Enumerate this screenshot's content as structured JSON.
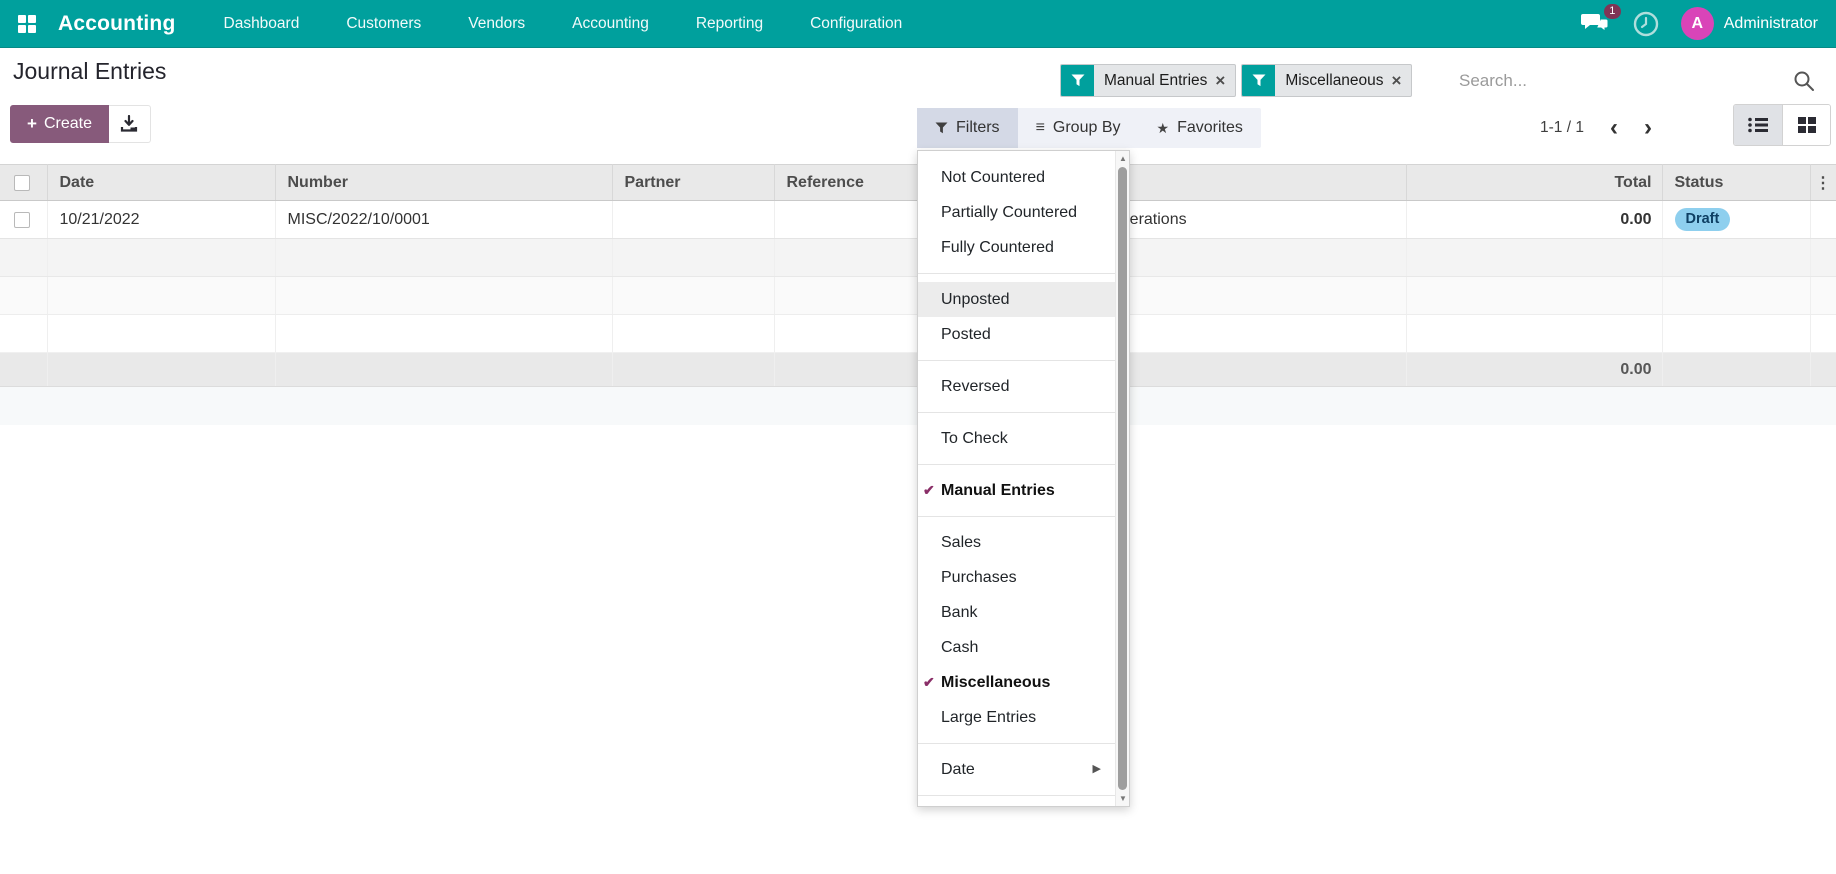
{
  "app": {
    "name": "Accounting",
    "menu_items": [
      "Dashboard",
      "Customers",
      "Vendors",
      "Accounting",
      "Reporting",
      "Configuration"
    ],
    "message_count": "1",
    "user_name": "Administrator",
    "user_initial": "A"
  },
  "page": {
    "title": "Journal Entries"
  },
  "toolbar": {
    "create_label": "Create"
  },
  "search": {
    "placeholder": "Search...",
    "facets": [
      {
        "label": "Manual Entries"
      },
      {
        "label": "Miscellaneous"
      }
    ]
  },
  "control_buttons": {
    "filters": "Filters",
    "group_by": "Group By",
    "favorites": "Favorites"
  },
  "pager": {
    "range": "1-1 / 1"
  },
  "table": {
    "headers": {
      "date": "Date",
      "number": "Number",
      "partner": "Partner",
      "reference": "Reference",
      "total": "Total",
      "status": "Status"
    },
    "rows": [
      {
        "date": "10/21/2022",
        "number": "MISC/2022/10/0001",
        "partner": "",
        "reference": "",
        "journal": "Miscellaneous Operations",
        "total": "0.00",
        "status": "Draft"
      }
    ],
    "aggregate_total": "0.00"
  },
  "filters_menu": {
    "items": [
      {
        "label": "Not Countered"
      },
      {
        "label": "Partially Countered"
      },
      {
        "label": "Fully Countered"
      },
      {
        "label": "Unposted",
        "highlighted": true
      },
      {
        "label": "Posted"
      },
      {
        "label": "Reversed"
      },
      {
        "label": "To Check"
      },
      {
        "label": "Manual Entries",
        "checked": true
      },
      {
        "label": "Sales"
      },
      {
        "label": "Purchases"
      },
      {
        "label": "Bank"
      },
      {
        "label": "Cash"
      },
      {
        "label": "Miscellaneous",
        "checked": true
      },
      {
        "label": "Large Entries"
      },
      {
        "label": "Date",
        "has_submenu": true
      }
    ]
  },
  "icons": {
    "plus": "+",
    "close": "×",
    "star": "★",
    "group_by": "≡",
    "chevron_left": "‹",
    "chevron_right": "›",
    "dots_vertical": "⋮",
    "check": "✔",
    "submenu_arrow": "▶",
    "scroll_up": "▲",
    "scroll_down": "▼"
  },
  "colors": {
    "navbar_teal": "#00a09d",
    "primary_purple": "#875a7b",
    "link_teal": "#1e7e9e",
    "check_plum": "#8a2f68",
    "draft_badge_bg": "#8ecfee",
    "avatar_magenta": "#d944b8"
  }
}
